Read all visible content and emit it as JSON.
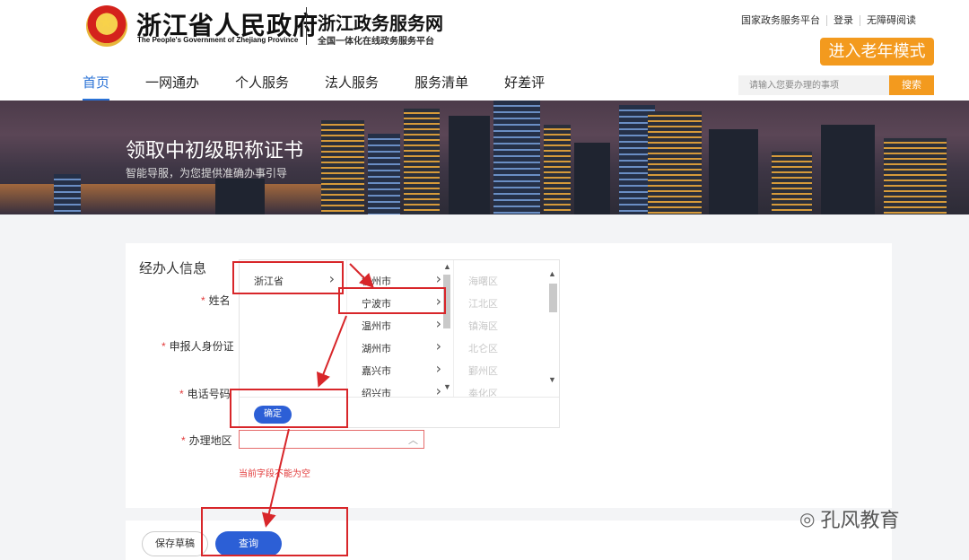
{
  "header": {
    "gov_title": "浙江省人民政府",
    "gov_title_en": "The People's Government of Zhejiang Province",
    "service_title": "浙江政务服务网",
    "service_subtitle": "全国一体化在线政务服务平台",
    "top_links": [
      "国家政务服务平台",
      "登录",
      "无障碍阅读"
    ],
    "elder_mode_label": "进入老年模式",
    "nav": [
      "首页",
      "一网通办",
      "个人服务",
      "法人服务",
      "服务清单",
      "好差评"
    ],
    "search_placeholder": "请输入您要办理的事项",
    "search_button": "搜索",
    "colors": {
      "accent": "#2a72d6",
      "orange": "#f39a1e"
    }
  },
  "banner": {
    "title": "领取中初级职称证书",
    "subtitle": "智能导服，为您提供准确办事引导"
  },
  "form": {
    "section_title": "经办人信息",
    "fields": {
      "name": "姓名",
      "id": "申报人身份证",
      "phone": "电话号码",
      "region": "办理地区"
    },
    "error_text": "当前字段不能为空",
    "cascader": {
      "provinces": [
        "浙江省"
      ],
      "cities": [
        "杭州市",
        "宁波市",
        "温州市",
        "湖州市",
        "嘉兴市",
        "绍兴市"
      ],
      "districts": [
        "海曙区",
        "江北区",
        "镇海区",
        "北仑区",
        "鄞州区",
        "奉化区"
      ],
      "confirm": "确定"
    },
    "save_draft": "保存草稿",
    "query": "查询"
  },
  "watermark": {
    "icon": "wechat-icon",
    "text": "孔风教育"
  },
  "annotation_color": "#d8262a"
}
